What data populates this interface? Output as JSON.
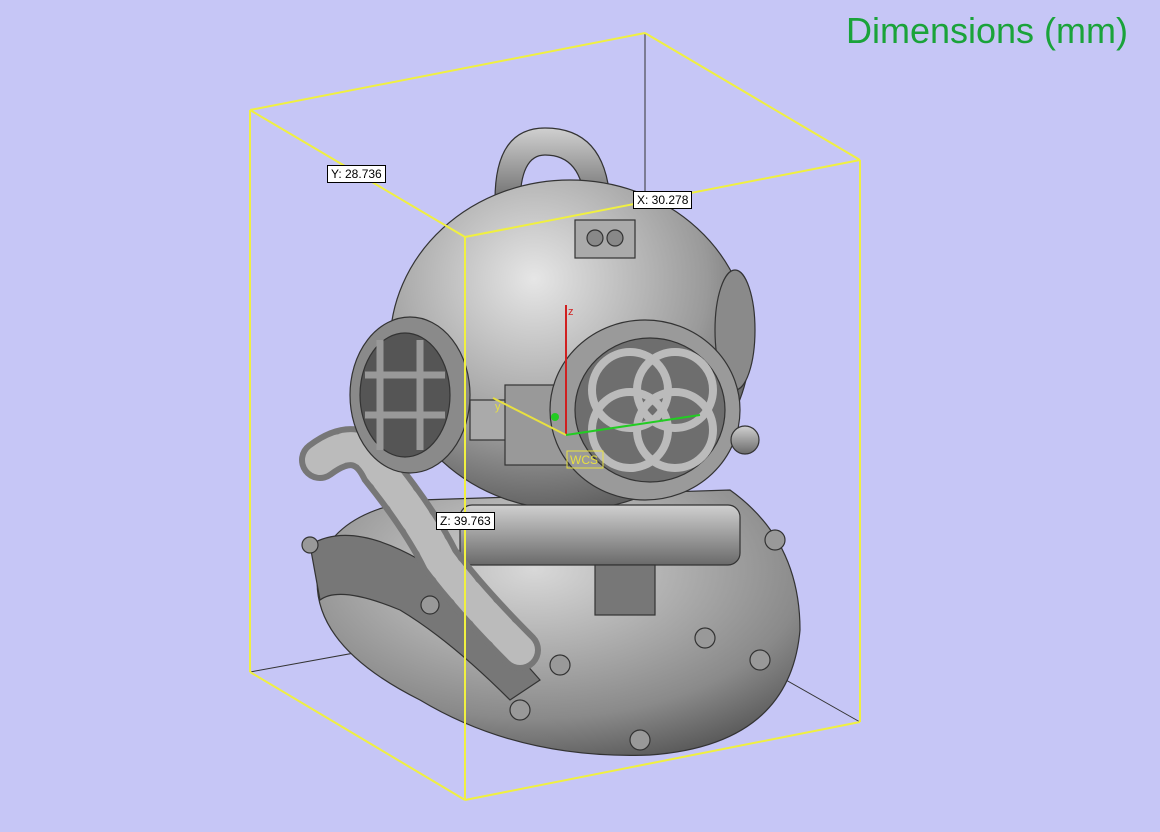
{
  "title": "Dimensions (mm)",
  "dimensions": {
    "x": "X: 30.278",
    "y": "Y: 28.736",
    "z": "Z: 39.763"
  },
  "axes": {
    "z_label": "z",
    "y_label": "y",
    "wcs_label": "WCS"
  },
  "colors": {
    "background": "#c6c6f6",
    "bounding_box": "#f0f040",
    "title": "#1aa33a",
    "axis_x": "#22cc22",
    "axis_y": "#e8e040",
    "axis_z": "#d02020",
    "model": "#9a9a9a"
  }
}
